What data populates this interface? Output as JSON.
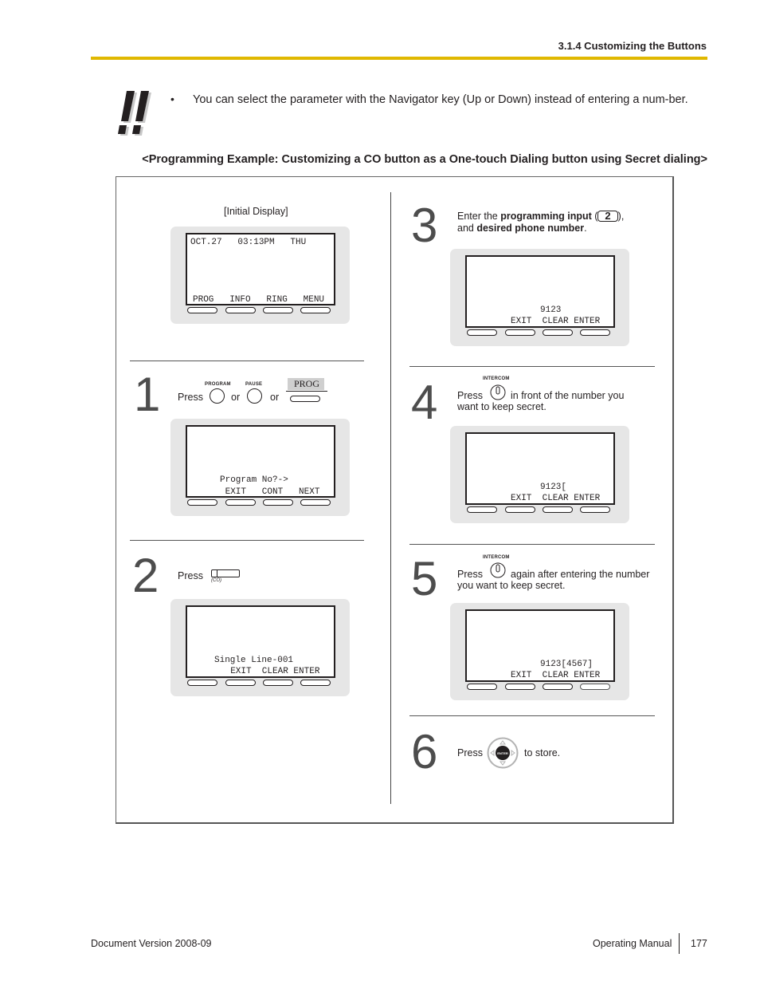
{
  "header": {
    "section_title": "3.1.4 Customizing the Buttons",
    "rule_color": "#e0b800"
  },
  "note": {
    "icon": "double-exclamation-icon",
    "bullet": "•",
    "text": "You can select the parameter with the Navigator key (Up or Down) instead of entering a num-ber."
  },
  "example_title": "<Programming Example: Customizing a CO button as a One-touch Dialing button using Secret dialing>",
  "initial": {
    "caption": "[Initial Display]",
    "display": {
      "line1": "OCT.27   03:13PM   THU",
      "softkeys": "PROG   INFO   RING   MENU"
    }
  },
  "steps": [
    {
      "number": "1",
      "press": "Press",
      "or1": "or",
      "or2": "or",
      "btn1_label": "PROGRAM",
      "btn2_label": "PAUSE",
      "soft_label": "PROG",
      "display": {
        "line1": "Program No?->",
        "softkeys": " EXIT   CONT   NEXT"
      }
    },
    {
      "number": "2",
      "press": "Press",
      "key_caption": "(CO)",
      "display": {
        "line1": "Single Line-001",
        "softkeys": "  EXIT  CLEAR ENTER"
      }
    },
    {
      "number": "3",
      "text_pre": "Enter the ",
      "text_bold1": "programming input",
      "text_mid": " (",
      "input_key": "2",
      "text_post": "),",
      "text_line2_pre": "and ",
      "text_bold2": "desired phone number",
      "text_end": ".",
      "display": {
        "line1": "9123",
        "softkeys": "EXIT  CLEAR ENTER"
      }
    },
    {
      "number": "4",
      "btn_label": "INTERCOM",
      "press": "Press",
      "text_after": "in front of the number you",
      "text_line2": "want to keep secret.",
      "display": {
        "line1": "9123[",
        "softkeys": "EXIT  CLEAR ENTER"
      }
    },
    {
      "number": "5",
      "btn_label": "INTERCOM",
      "press": "Press",
      "text_after": "again after entering the number",
      "text_line2": "you want to keep secret.",
      "display": {
        "line1": "9123[4567]",
        "softkeys": "EXIT  CLEAR ENTER"
      }
    },
    {
      "number": "6",
      "press": "Press",
      "enter_label": "ENTER",
      "text_after": "to store."
    }
  ],
  "footer": {
    "doc_version": "Document Version  2008-09",
    "manual": "Operating Manual",
    "page": "177"
  }
}
